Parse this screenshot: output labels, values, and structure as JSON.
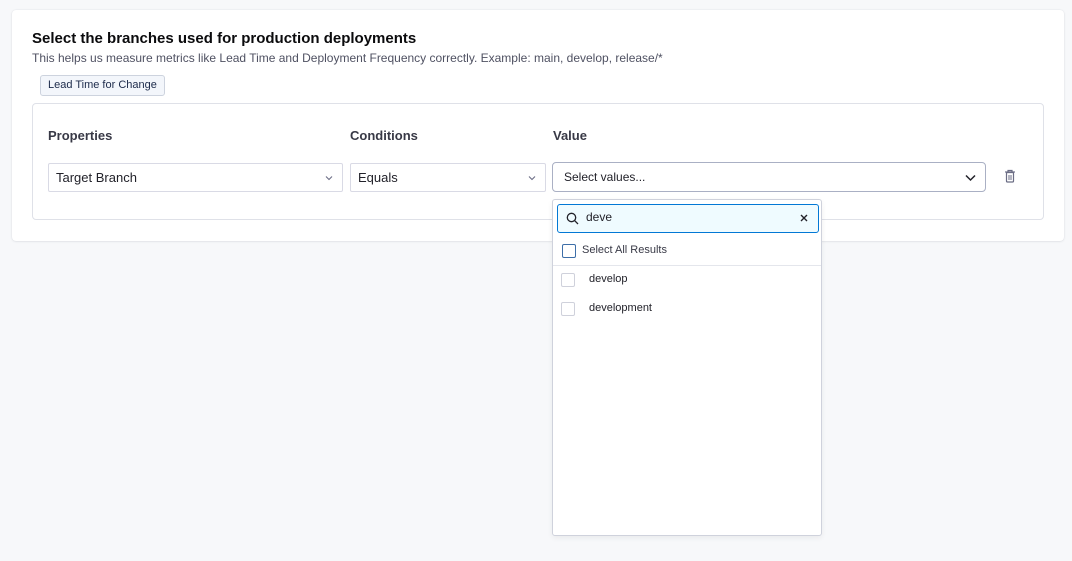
{
  "section": {
    "title": "Select the branches used for production deployments",
    "subtitle": "This helps us measure metrics like Lead Time and Deployment Frequency correctly. Example: main, develop, release/*",
    "tag": "Lead Time for Change"
  },
  "rule": {
    "headers": {
      "properties": "Properties",
      "conditions": "Conditions",
      "value": "Value"
    },
    "property_value": "Target Branch",
    "condition_value": "Equals",
    "value_placeholder": "Select values..."
  },
  "dropdown": {
    "search_value": "deve",
    "select_all_label": "Select All Results",
    "options": [
      {
        "label": "develop",
        "checked": false
      },
      {
        "label": "development",
        "checked": false
      }
    ]
  },
  "icons": {
    "chevron": "chevron-down-icon",
    "delete": "trash-icon",
    "search": "search-icon",
    "clear": "close-icon"
  },
  "colors": {
    "accent": "#0278d5",
    "search_bg": "#effbff",
    "tag_bg": "#f3f6fb"
  }
}
